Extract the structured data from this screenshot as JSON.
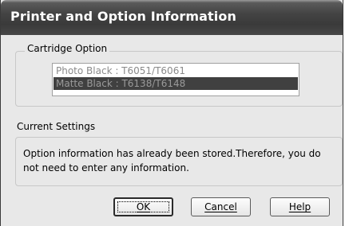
{
  "window": {
    "title": "Printer and Option Information"
  },
  "cartridge": {
    "group_label": "Cartridge Option",
    "options": [
      "Photo Black : T6051/T6061",
      "Matte Black : T6138/T6148"
    ],
    "selected_index": 1
  },
  "current_settings": {
    "label": "Current Settings",
    "message": "Option information has already been stored.Therefore, you do not need to enter any information."
  },
  "buttons": {
    "ok": "OK",
    "cancel": "Cancel",
    "help": "Help"
  }
}
